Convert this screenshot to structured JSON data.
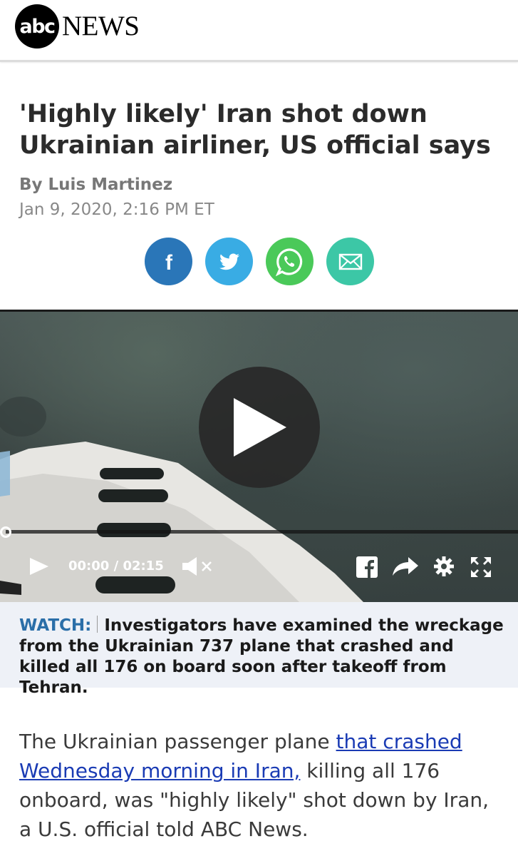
{
  "header": {
    "logo_abc": "abc",
    "logo_news": "NEWS"
  },
  "article": {
    "headline": "'Highly likely' Iran shot down Ukrainian airliner, US official says",
    "byline": "By Luis Martinez",
    "date": "Jan 9, 2020, 2:16 PM ET"
  },
  "share": {
    "icons": [
      "facebook-icon",
      "twitter-icon",
      "whatsapp-icon",
      "email-icon"
    ],
    "colors": {
      "facebook": "#2a76b8",
      "twitter": "#39ace4",
      "whatsapp": "#4ac959",
      "email": "#3cc7a6"
    }
  },
  "video": {
    "current_time": "00:00",
    "separator": "/",
    "duration": "02:15",
    "progress": 0
  },
  "caption": {
    "label": "WATCH:",
    "text": "Investigators have examined the wreckage from the Ukrainian 737 plane that crashed and killed all 176 on board soon after takeoff from Tehran."
  },
  "body": {
    "text_before": "The Ukrainian passenger plane ",
    "link_text": "that crashed Wednesday morning in Iran,",
    "text_after": " killing all 176 onboard, was \"highly likely\" shot down by Iran, a U.S. official told ABC News."
  },
  "colors": {
    "link": "#1a3bb4",
    "watch_label": "#2a6ea8",
    "caption_bg": "#eef1f7"
  }
}
